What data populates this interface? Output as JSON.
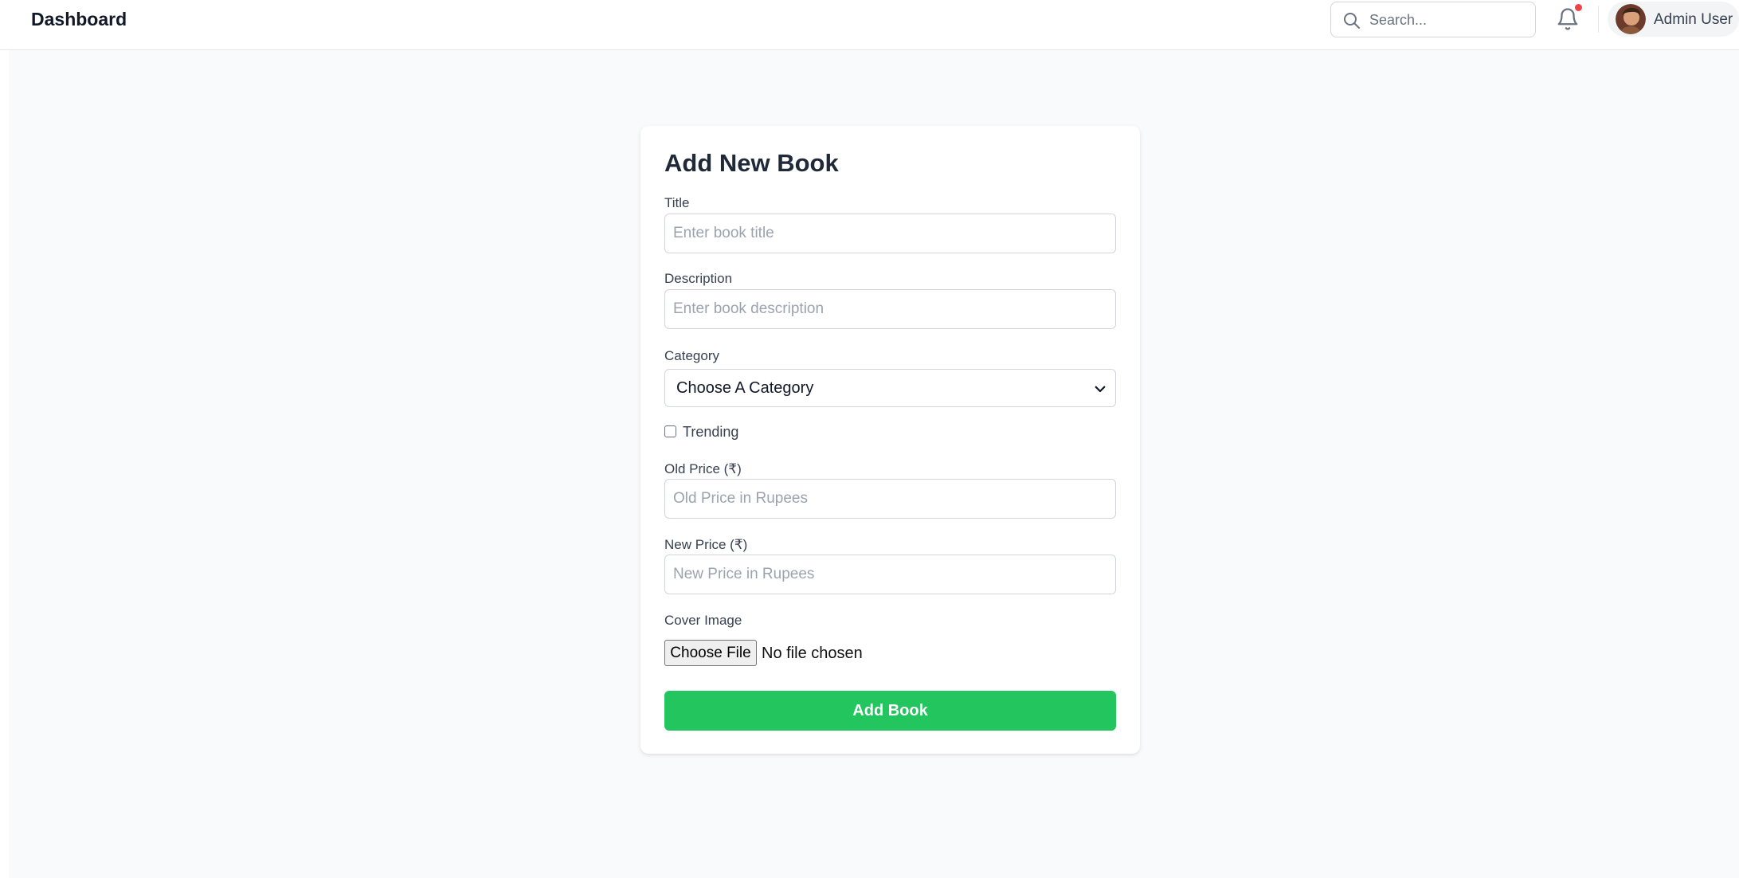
{
  "header": {
    "title": "Dashboard",
    "search_placeholder": "Search...",
    "user_name": "Admin User",
    "notification_dot_color": "#ef4444"
  },
  "form": {
    "heading": "Add New Book",
    "title_label": "Title",
    "title_placeholder": "Enter book title",
    "description_label": "Description",
    "description_placeholder": "Enter book description",
    "category_label": "Category",
    "category_selected": "Choose A Category",
    "trending_label": "Trending",
    "trending_checked": false,
    "old_price_label": "Old Price (₹)",
    "old_price_placeholder": "Old Price in Rupees",
    "new_price_label": "New Price (₹)",
    "new_price_placeholder": "New Price in Rupees",
    "cover_label": "Cover Image",
    "file_button": "Choose File",
    "file_status": "No file chosen",
    "submit_label": "Add Book",
    "submit_color": "#22c55e"
  },
  "icons": {
    "search": "search-icon",
    "notifications": "bell-icon",
    "dropdown": "chevron-down-icon",
    "avatar": "avatar"
  }
}
